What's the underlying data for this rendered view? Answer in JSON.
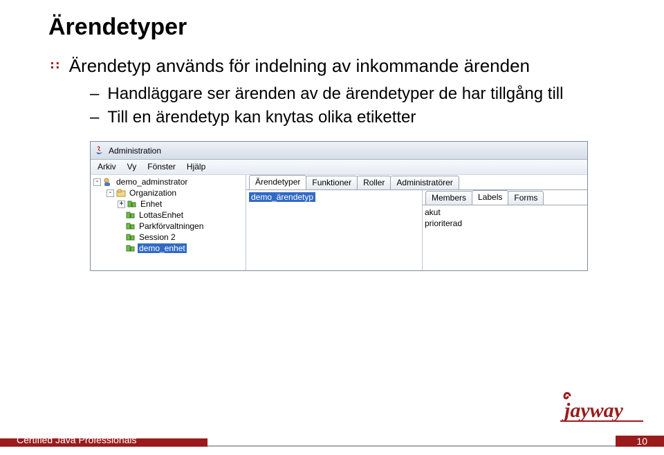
{
  "title": "Ärendetyper",
  "bullet_main": "Ärendetyp används för indelning av inkommande ärenden",
  "sub_bullets": [
    "Handläggare ser ärenden av de ärendetyper de har tillgång till",
    "Till en ärendetyp kan knytas olika etiketter"
  ],
  "window": {
    "title": "Administration",
    "menu": [
      "Arkiv",
      "Vy",
      "Fönster",
      "Hjälp"
    ],
    "tree": {
      "root": "demo_adminstrator",
      "org": "Organization",
      "items": [
        "Enhet",
        "LottasEnhet",
        "Parkförvaltningen",
        "Session 2",
        "demo_enhet"
      ]
    },
    "tabs_main": [
      "Ärendetyper",
      "Funktioner",
      "Roller",
      "Administratörer"
    ],
    "type_list": [
      "demo_ärendetyp"
    ],
    "tabs_detail": [
      "Members",
      "Labels",
      "Forms"
    ],
    "labels": [
      "akut",
      "prioriterad"
    ]
  },
  "footer": {
    "text": "Certified Java Professionals",
    "page": "10",
    "logo_text": "jayway"
  }
}
